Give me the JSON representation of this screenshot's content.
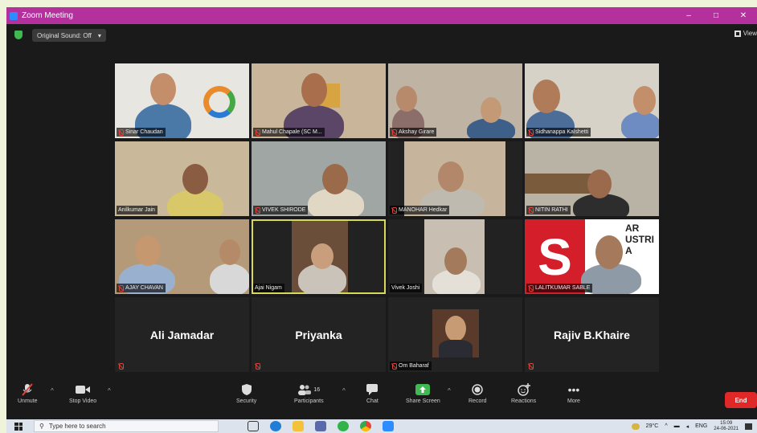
{
  "window": {
    "title": "Zoom Meeting",
    "controls": [
      "–",
      "□",
      "✕"
    ]
  },
  "topbar": {
    "sound_label": "Original Sound: Off",
    "sound_caret": "▾",
    "view_label": "View"
  },
  "participants": [
    {
      "name": "Sinar Chaudan"
    },
    {
      "name": "Mahul Chapale (SC M..."
    },
    {
      "name": "Akshay Girare"
    },
    {
      "name": "Sidhanappa Kalshetti"
    },
    {
      "name": "Anilkumar Jain"
    },
    {
      "name": "VIVEK SHIRODE"
    },
    {
      "name": "MANOHAR Hedkar"
    },
    {
      "name": "NITIN RATHI"
    },
    {
      "name": "AJAY CHAVAN"
    },
    {
      "name": "Ajai Nigam"
    },
    {
      "name": "Vivek Joshi"
    },
    {
      "name": "LALITKUMAR SABLE"
    },
    {
      "name": "Ali Jamadar"
    },
    {
      "name": "Priyanka"
    },
    {
      "name": "Om Baharaf"
    },
    {
      "name": "Rajiv B.Khaire"
    }
  ],
  "tile_background_text": {
    "logo_letters": "S",
    "banner_text": "AR\nUSTRI\nA"
  },
  "toolbar": {
    "unmute": "Unmute",
    "stop_video": "Stop Video",
    "security": "Security",
    "participants": "Participants",
    "participants_count": "16",
    "chat": "Chat",
    "share_screen": "Share Screen",
    "record": "Record",
    "reactions": "Reactions",
    "more": "More",
    "end": "End"
  },
  "taskbar": {
    "search_placeholder": "Type here to search",
    "temperature": "29°C",
    "language": "ENG",
    "time": "15:09",
    "date": "24-06-2021"
  },
  "colors": {
    "title_bar": "#b4309c",
    "end_button": "#e02828",
    "active_speaker_border": "#d8d85a",
    "mic_muted": "#e0433a"
  }
}
